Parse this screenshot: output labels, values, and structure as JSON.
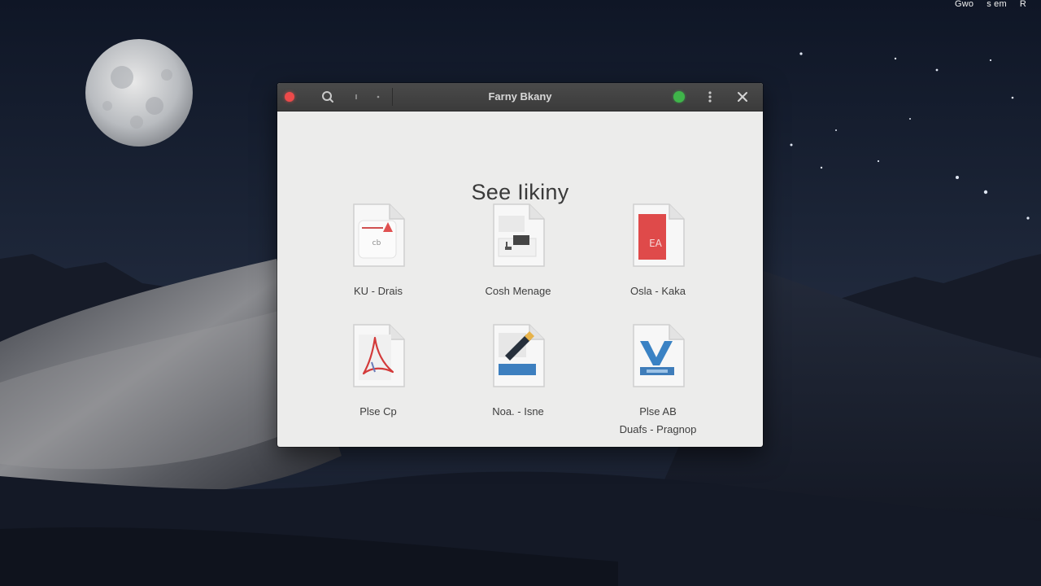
{
  "menubar": {
    "items": [
      "Gwo",
      "s em",
      "R"
    ]
  },
  "window": {
    "title": "Farny Bkany",
    "heading": "See Iikiny"
  },
  "apps": [
    {
      "label": "KU - Drais",
      "icon": "warning-document-icon"
    },
    {
      "label": "Cosh Menage",
      "icon": "form-document-icon"
    },
    {
      "label": "Osla - Kaka",
      "icon": "red-cover-document-icon",
      "badge": "EA"
    },
    {
      "label": "Plse Cp",
      "icon": "acrobat-document-icon"
    },
    {
      "label": "Noa. - Isne",
      "icon": "pencil-document-icon"
    },
    {
      "label": "Plse AB",
      "label2": "Duafs - Pragnop",
      "icon": "v-logo-document-icon"
    }
  ],
  "colors": {
    "accent_red": "#ec4a4a",
    "status_green": "#3fb54a",
    "window_bg": "#ececeb",
    "titlebar": "#3f3f3f"
  }
}
